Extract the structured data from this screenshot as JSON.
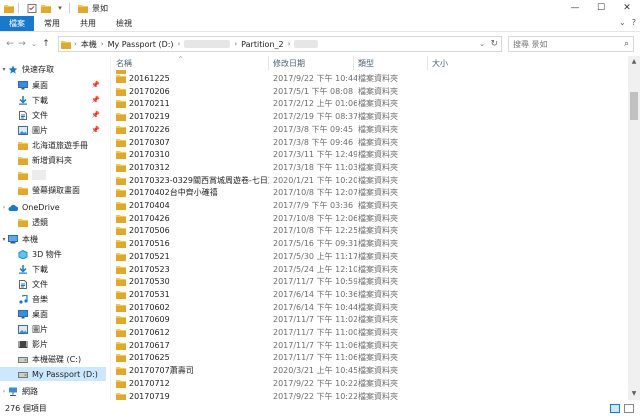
{
  "window": {
    "title": "景如",
    "controls": {
      "minimize": "—",
      "maximize": "☐",
      "close": "✕"
    }
  },
  "ribbon": {
    "tabs": [
      "檔案",
      "常用",
      "共用",
      "檢視"
    ],
    "expand": "⌄",
    "help": "?"
  },
  "address": {
    "back": "←",
    "forward": "→",
    "recent": "⌄",
    "up": "↑",
    "crumbs": [
      "本機",
      "My Passport (D:)",
      "",
      "Partition_2",
      ""
    ],
    "separator": "›",
    "dropdown": "⌄",
    "refresh": "↻"
  },
  "search": {
    "placeholder": "搜尋 景如",
    "icon": "search-icon"
  },
  "nav": {
    "items": [
      {
        "label": "快速存取",
        "icon": "star-icon",
        "expanded": true
      },
      {
        "label": "桌面",
        "icon": "desktop-icon",
        "pinned": true
      },
      {
        "label": "下載",
        "icon": "download-icon",
        "pinned": true
      },
      {
        "label": "文件",
        "icon": "document-icon",
        "pinned": true
      },
      {
        "label": "圖片",
        "icon": "picture-icon",
        "pinned": true
      },
      {
        "label": "北海道旅遊手冊",
        "icon": "folder-icon"
      },
      {
        "label": "新增資料夾",
        "icon": "folder-icon"
      },
      {
        "label": "",
        "icon": "folder-icon"
      },
      {
        "label": "螢幕擷取畫面",
        "icon": "folder-icon"
      },
      {
        "label": "OneDrive",
        "icon": "cloud-icon"
      },
      {
        "label": "透鏡",
        "icon": "folder-icon"
      },
      {
        "label": "本機",
        "icon": "pc-icon"
      },
      {
        "label": "3D 物件",
        "icon": "cube-icon"
      },
      {
        "label": "下載",
        "icon": "download-icon"
      },
      {
        "label": "文件",
        "icon": "document-icon"
      },
      {
        "label": "音樂",
        "icon": "music-icon"
      },
      {
        "label": "桌面",
        "icon": "desktop-icon"
      },
      {
        "label": "圖片",
        "icon": "picture-icon"
      },
      {
        "label": "影片",
        "icon": "video-icon"
      },
      {
        "label": "本機磁碟 (C:)",
        "icon": "drive-icon"
      },
      {
        "label": "My Passport (D:)",
        "icon": "drive-icon",
        "selected": true
      },
      {
        "label": "網路",
        "icon": "network-icon"
      }
    ],
    "pin_glyph": "📌"
  },
  "columns": {
    "name": "名稱",
    "date": "修改日期",
    "type": "類型",
    "size": "大小",
    "sort_glyph": "^"
  },
  "files": [
    {
      "name": "20161225",
      "date": "2017/9/22 下午 10:44",
      "type": "檔案資料夾"
    },
    {
      "name": "20170206",
      "date": "2017/5/1 下午 08:08",
      "type": "檔案資料夾"
    },
    {
      "name": "20170211",
      "date": "2017/2/12 上午 01:06",
      "type": "檔案資料夾"
    },
    {
      "name": "20170219",
      "date": "2017/2/19 下午 08:37",
      "type": "檔案資料夾"
    },
    {
      "name": "20170226",
      "date": "2017/3/8 下午 09:45",
      "type": "檔案資料夾"
    },
    {
      "name": "20170307",
      "date": "2017/3/8 下午 09:46",
      "type": "檔案資料夾"
    },
    {
      "name": "20170310",
      "date": "2017/3/11 下午 12:49",
      "type": "檔案資料夾"
    },
    {
      "name": "20170312",
      "date": "2017/3/18 下午 11:03",
      "type": "檔案資料夾"
    },
    {
      "name": "20170323-0329關西賞城周遊卷-七日京...",
      "date": "2020/1/21 下午 10:20",
      "type": "檔案資料夾"
    },
    {
      "name": "20170402台中齊小確禧",
      "date": "2017/10/8 下午 12:07",
      "type": "檔案資料夾"
    },
    {
      "name": "20170404",
      "date": "2017/7/9 下午 03:36",
      "type": "檔案資料夾"
    },
    {
      "name": "20170426",
      "date": "2017/10/8 下午 12:06",
      "type": "檔案資料夾"
    },
    {
      "name": "20170506",
      "date": "2017/10/8 下午 12:25",
      "type": "檔案資料夾"
    },
    {
      "name": "20170516",
      "date": "2017/5/16 下午 09:31",
      "type": "檔案資料夾"
    },
    {
      "name": "20170521",
      "date": "2017/5/30 上午 11:17",
      "type": "檔案資料夾"
    },
    {
      "name": "20170523",
      "date": "2017/5/24 上午 12:10",
      "type": "檔案資料夾"
    },
    {
      "name": "20170530",
      "date": "2017/11/7 下午 10:59",
      "type": "檔案資料夾"
    },
    {
      "name": "20170531",
      "date": "2017/6/14 下午 10:36",
      "type": "檔案資料夾"
    },
    {
      "name": "20170602",
      "date": "2017/6/14 下午 10:44",
      "type": "檔案資料夾"
    },
    {
      "name": "20170609",
      "date": "2017/11/7 下午 11:02",
      "type": "檔案資料夾"
    },
    {
      "name": "20170612",
      "date": "2017/11/7 下午 11:00",
      "type": "檔案資料夾"
    },
    {
      "name": "20170617",
      "date": "2017/11/7 下午 11:06",
      "type": "檔案資料夾"
    },
    {
      "name": "20170625",
      "date": "2017/11/7 下午 11:06",
      "type": "檔案資料夾"
    },
    {
      "name": "20170707蕭壽司",
      "date": "2020/3/21 上午 10:45",
      "type": "檔案資料夾"
    },
    {
      "name": "20170712",
      "date": "2017/9/22 下午 10:22",
      "type": "檔案資料夾"
    },
    {
      "name": "20170719",
      "date": "2017/9/22 下午 10:22",
      "type": "檔案資料夾"
    }
  ],
  "status": {
    "count": "276 個項目"
  },
  "colors": {
    "accent": "#1979ca",
    "selected": "#cce8ff",
    "folder": "#f7c948",
    "folder_dark": "#e0a82e"
  }
}
